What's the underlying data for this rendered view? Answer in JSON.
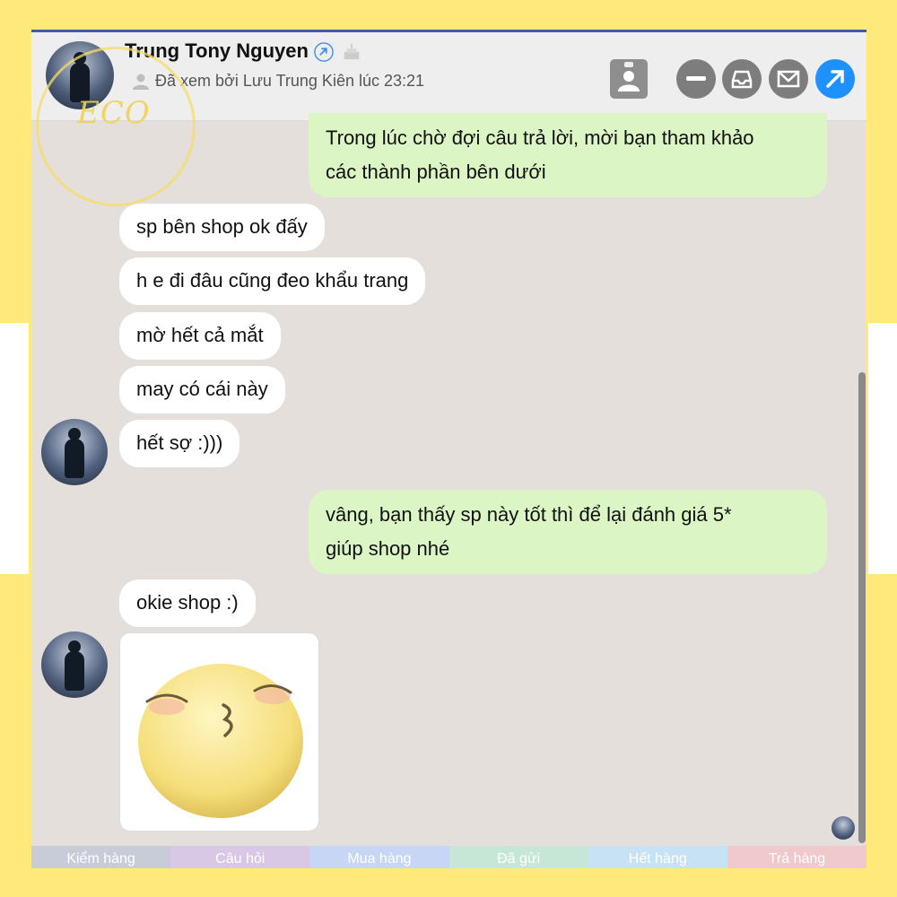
{
  "header": {
    "name": "Trung Tony Nguyen",
    "seen_text": "Đã xem bởi Lưu Trung Kiên lúc 23:21"
  },
  "messages": [
    {
      "direction": "out",
      "text_line1": "Trong lúc chờ đợi câu trả lời, mời bạn tham khảo",
      "text_line2": "các thành phần bên dưới"
    },
    {
      "direction": "in",
      "text": "sp bên shop ok đấy"
    },
    {
      "direction": "in",
      "text": "h e đi đâu cũng đeo khẩu trang"
    },
    {
      "direction": "in",
      "text": "mờ hết cả mắt"
    },
    {
      "direction": "in",
      "text": "may có cái này"
    },
    {
      "direction": "in",
      "text": "hết sợ :)))"
    },
    {
      "direction": "out",
      "text_line1": "vâng, bạn thấy sp này tốt thì để lại đánh giá 5*",
      "text_line2": "giúp shop nhé"
    },
    {
      "direction": "in",
      "text": "okie shop :)"
    }
  ],
  "tabs": [
    "Kiểm hàng",
    "Câu hỏi",
    "Mua hàng",
    "Đã gửi",
    "Hết hàng",
    "Trả hàng"
  ],
  "icons": {
    "link": "link-icon",
    "cake": "birthday-cake-icon",
    "contact": "contact-card-icon",
    "minimize": "minus-icon",
    "inbox": "inbox-icon",
    "mail": "mail-icon",
    "open": "arrow-up-right-icon"
  },
  "colors": {
    "outgoing_bubble": "#dbf5c5",
    "incoming_bubble": "#ffffff",
    "chat_background": "#e4dfdb",
    "accent": "#1e90ff"
  }
}
